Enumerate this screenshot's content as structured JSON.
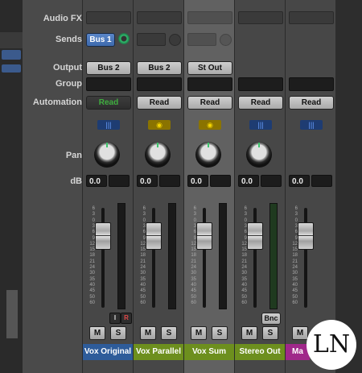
{
  "labels": {
    "audio_fx": "Audio FX",
    "sends": "Sends",
    "output": "Output",
    "group": "Group",
    "automation": "Automation",
    "pan": "Pan",
    "db": "dB"
  },
  "strips": [
    {
      "name": "Vox Original",
      "name_color": "#2e5c9a",
      "send": "Bus 1",
      "output": "Bus 2",
      "automation": "Read",
      "automation_active": true,
      "group_icon": "blue",
      "db": "0.0",
      "has_IR": true,
      "has_bnc": false
    },
    {
      "name": "Vox Parallel",
      "name_color": "#6d8f1e",
      "send": "",
      "output": "Bus 2",
      "automation": "Read",
      "automation_active": false,
      "group_icon": "yellow",
      "db": "0.0",
      "has_IR": false,
      "has_bnc": false
    },
    {
      "name": "Vox Sum",
      "name_color": "#6d8f1e",
      "send": "",
      "output": "St Out",
      "automation": "Read",
      "automation_active": false,
      "group_icon": "yellow",
      "db": "0.0",
      "has_IR": false,
      "has_bnc": false
    },
    {
      "name": "Stereo Out",
      "name_color": "#6d8f1e",
      "send": "",
      "output": "",
      "automation": "Read",
      "automation_active": false,
      "group_icon": "blue",
      "db": "0.0",
      "has_IR": false,
      "has_bnc": true
    },
    {
      "name": "Ma",
      "name_color": "#a0288a",
      "send": "",
      "output": "",
      "automation": "Read",
      "automation_active": false,
      "group_icon": "blue",
      "db": "0.0",
      "has_IR": false,
      "has_bnc": false
    }
  ],
  "buttons": {
    "mute": "M",
    "solo": "S",
    "input": "I",
    "record": "R",
    "bounce": "Bnc"
  },
  "scale_ticks": [
    "6",
    "3",
    "0",
    "3",
    "6",
    "9",
    "12",
    "15",
    "18",
    "21",
    "24",
    "30",
    "35",
    "40",
    "45",
    "50",
    "60"
  ],
  "logo": "LN"
}
